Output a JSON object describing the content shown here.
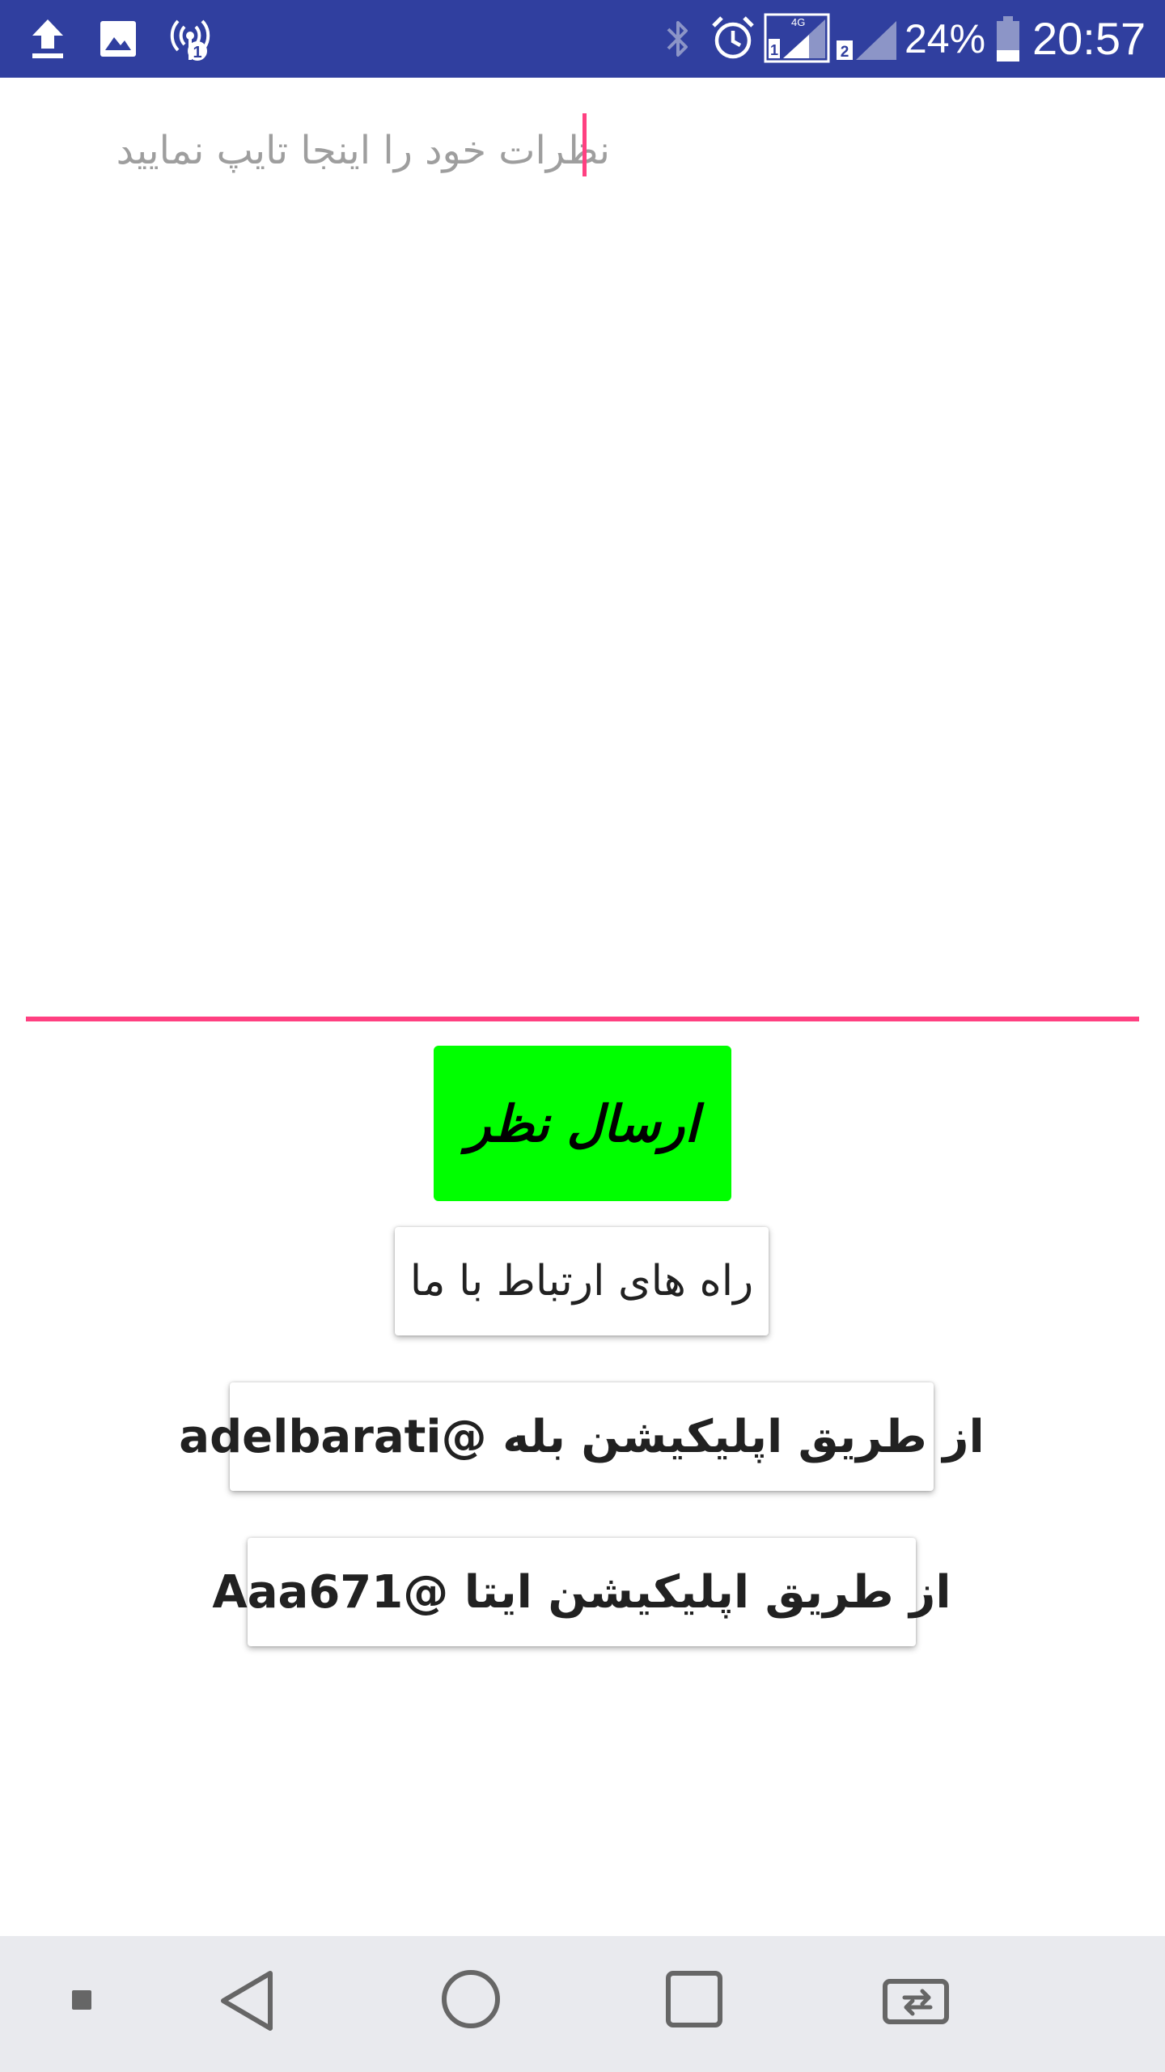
{
  "status_bar": {
    "left_icons": [
      "upload-icon",
      "image-icon",
      "hotspot-icon"
    ],
    "right_icons": [
      "bluetooth-icon",
      "alarm-icon",
      "sim1-signal-icon",
      "sim2-signal-icon",
      "battery-icon"
    ],
    "sim1_network": "4G",
    "sim1_label": "1",
    "sim2_label": "2",
    "hotspot_badge": "1",
    "battery_percent": "24%",
    "time": "20:57",
    "background_color": "#303f9f"
  },
  "comment": {
    "placeholder": "نظرات خود را اینجا تایپ نمایید",
    "value": "",
    "accent_color": "#ff4081"
  },
  "submit": {
    "label": "ارسال نظر",
    "color": "#00ff00"
  },
  "contact": {
    "label": "راه های ارتباط با ما"
  },
  "bale": {
    "label": "از طریق اپلیکیشن بله @adelbarati"
  },
  "eitaa": {
    "label": "از طریق اپلیکیشن ایتا @Aaa671"
  },
  "nav_bar": {
    "icons": [
      "small-square-icon",
      "back-icon",
      "home-icon",
      "recents-icon",
      "switch-icon"
    ],
    "background_color": "#e9eaee"
  }
}
